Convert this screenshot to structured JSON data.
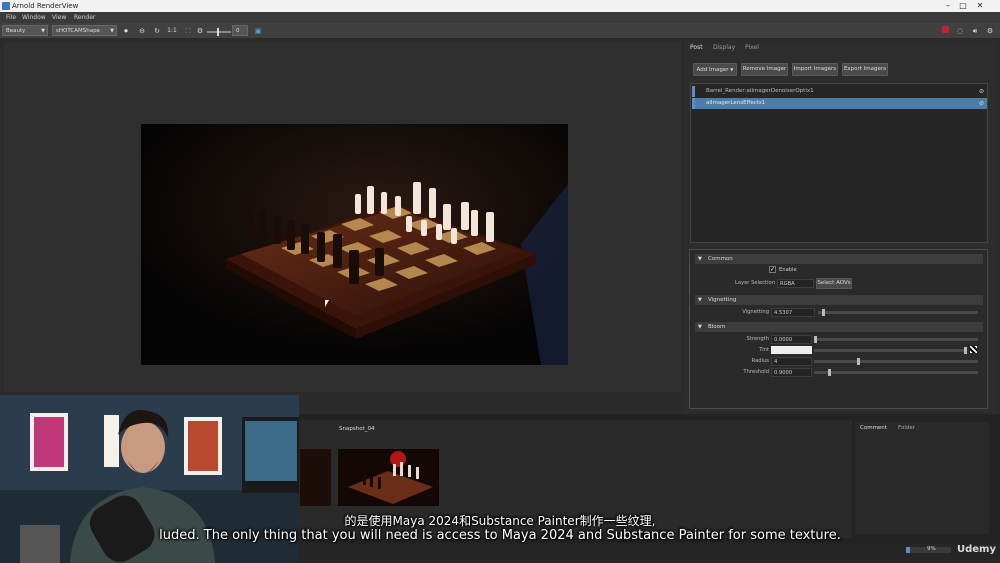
{
  "window": {
    "title": "Arnold RenderView"
  },
  "menu": [
    "File",
    "Window",
    "View",
    "Render"
  ],
  "toolbar": {
    "aov_select": "Beauty",
    "camera_select": "sHOTCAMShape",
    "ratio_label": "1:1",
    "exposure_value": "0"
  },
  "right_panel": {
    "tabs": [
      "Post",
      "Display",
      "Pixel"
    ],
    "buttons": {
      "add_imager": "Add Imager",
      "remove_imager": "Remove Imager",
      "import_imagers": "Import Imagers",
      "export_imagers": "Export Imagers"
    },
    "imagers": [
      {
        "name": "Barrel_Render:aiImagerDenoiserOptix1",
        "selected": false
      },
      {
        "name": "aiImagerLensEffects1",
        "selected": true
      }
    ],
    "sections": {
      "common": {
        "title": "Common",
        "enable_label": "Enable",
        "layer_selection_label": "Layer Selection",
        "layer_selection_value": "RGBA",
        "select_aovs": "Select AOVs"
      },
      "vignetting": {
        "title": "Vignetting",
        "vignetting_label": "Vignetting",
        "vignetting_value": "4.5307",
        "vignetting_level": 0.04
      },
      "bloom": {
        "title": "Bloom",
        "strength_label": "Strength",
        "strength_value": "0.0000",
        "strength_level": 0.0,
        "tint_label": "Tint",
        "radius_label": "Radius",
        "radius_value": "4",
        "radius_level": 0.2,
        "threshold_label": "Threshold",
        "threshold_value": "0.9000",
        "threshold_level": 0.1
      }
    }
  },
  "snapshots": {
    "label": "Snapshot_04"
  },
  "comments": {
    "tabs": [
      "Comment",
      "Folder"
    ]
  },
  "status": {
    "progress_text": "9%",
    "progress": 0.09,
    "watermark": "Udemy"
  },
  "subtitles": {
    "line1": "的是使用Maya 2024和Substance Painter制作一些纹理,",
    "line2": "luded. The only thing that you will need is access to Maya 2024 and Substance Painter for some texture."
  },
  "colors": {
    "accent": "#5b8fc8",
    "selected_row": "#4a7ea8",
    "record_red": "#c8202a"
  }
}
